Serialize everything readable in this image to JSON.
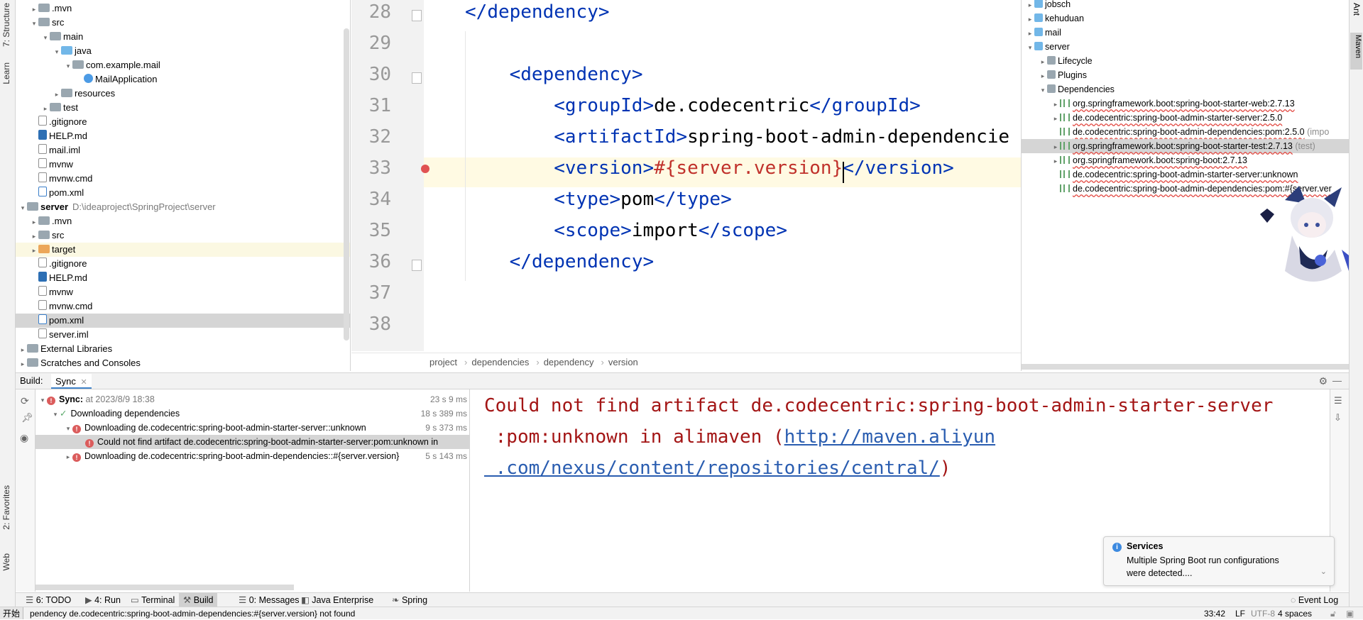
{
  "left_stripe": {
    "tabs": [
      "7: Structure",
      "Learn",
      "2: Favorites",
      "Web"
    ]
  },
  "project_tree": [
    {
      "label": ".mvn",
      "type": "folder",
      "depth": 1,
      "arrow": "▸"
    },
    {
      "label": "src",
      "type": "folder",
      "depth": 1,
      "arrow": "▾"
    },
    {
      "label": "main",
      "type": "folder",
      "depth": 2,
      "arrow": "▾"
    },
    {
      "label": "java",
      "type": "folder-blue",
      "depth": 3,
      "arrow": "▾"
    },
    {
      "label": "com.example.mail",
      "type": "folder",
      "depth": 4,
      "arrow": "▾"
    },
    {
      "label": "MailApplication",
      "type": "java",
      "depth": 5,
      "arrow": ""
    },
    {
      "label": "resources",
      "type": "folder",
      "depth": 3,
      "arrow": "▸"
    },
    {
      "label": "test",
      "type": "folder",
      "depth": 2,
      "arrow": "▸"
    },
    {
      "label": ".gitignore",
      "type": "file",
      "depth": 1,
      "arrow": ""
    },
    {
      "label": "HELP.md",
      "type": "md",
      "depth": 1,
      "arrow": ""
    },
    {
      "label": "mail.iml",
      "type": "file",
      "depth": 1,
      "arrow": ""
    },
    {
      "label": "mvnw",
      "type": "file",
      "depth": 1,
      "arrow": ""
    },
    {
      "label": "mvnw.cmd",
      "type": "file",
      "depth": 1,
      "arrow": ""
    },
    {
      "label": "pom.xml",
      "type": "xml",
      "depth": 1,
      "arrow": ""
    },
    {
      "label": "server",
      "type": "folder",
      "depth": 0,
      "arrow": "▾",
      "bold": true,
      "path": "D:\\ideaproject\\SpringProject\\server"
    },
    {
      "label": ".mvn",
      "type": "folder",
      "depth": 1,
      "arrow": "▸"
    },
    {
      "label": "src",
      "type": "folder",
      "depth": 1,
      "arrow": "▸"
    },
    {
      "label": "target",
      "type": "folder-orange",
      "depth": 1,
      "arrow": "▸",
      "highlight": true
    },
    {
      "label": ".gitignore",
      "type": "file",
      "depth": 1,
      "arrow": ""
    },
    {
      "label": "HELP.md",
      "type": "md",
      "depth": 1,
      "arrow": ""
    },
    {
      "label": "mvnw",
      "type": "file",
      "depth": 1,
      "arrow": ""
    },
    {
      "label": "mvnw.cmd",
      "type": "file",
      "depth": 1,
      "arrow": ""
    },
    {
      "label": "pom.xml",
      "type": "xml",
      "depth": 1,
      "arrow": "",
      "selected": true
    },
    {
      "label": "server.iml",
      "type": "file",
      "depth": 1,
      "arrow": ""
    },
    {
      "label": "External Libraries",
      "type": "lib",
      "depth": 0,
      "arrow": "▸"
    },
    {
      "label": "Scratches and Consoles",
      "type": "scratch",
      "depth": 0,
      "arrow": "▸"
    }
  ],
  "editor": {
    "line_numbers": [
      "28",
      "29",
      "30",
      "31",
      "32",
      "33",
      "34",
      "35",
      "36",
      "37",
      "38"
    ],
    "lines": [
      {
        "indent": "",
        "parts": [
          {
            "t": "</",
            "c": "tag"
          },
          {
            "t": "dependency",
            "c": "tag"
          },
          {
            "t": ">",
            "c": "tag"
          }
        ]
      },
      {
        "indent": "",
        "parts": []
      },
      {
        "indent": "    ",
        "parts": [
          {
            "t": "<",
            "c": "tag"
          },
          {
            "t": "dependency",
            "c": "tag"
          },
          {
            "t": ">",
            "c": "tag"
          }
        ]
      },
      {
        "indent": "        ",
        "parts": [
          {
            "t": "<",
            "c": "tag"
          },
          {
            "t": "groupId",
            "c": "tag"
          },
          {
            "t": ">",
            "c": "tag"
          },
          {
            "t": "de.codecentric",
            "c": ""
          },
          {
            "t": "</",
            "c": "tag"
          },
          {
            "t": "groupId",
            "c": "tag"
          },
          {
            "t": ">",
            "c": "tag"
          }
        ]
      },
      {
        "indent": "        ",
        "parts": [
          {
            "t": "<",
            "c": "tag"
          },
          {
            "t": "artifactId",
            "c": "tag"
          },
          {
            "t": ">",
            "c": "tag"
          },
          {
            "t": "spring-boot-admin-dependencie",
            "c": ""
          }
        ]
      },
      {
        "indent": "        ",
        "parts": [
          {
            "t": "<",
            "c": "tag"
          },
          {
            "t": "version",
            "c": "tag"
          },
          {
            "t": ">",
            "c": "tag"
          },
          {
            "t": "#{server.version}",
            "c": "err"
          },
          {
            "t": "</",
            "c": "tag"
          },
          {
            "t": "version",
            "c": "tag"
          },
          {
            "t": ">",
            "c": "tag"
          }
        ]
      },
      {
        "indent": "        ",
        "parts": [
          {
            "t": "<",
            "c": "tag"
          },
          {
            "t": "type",
            "c": "tag"
          },
          {
            "t": ">",
            "c": "tag"
          },
          {
            "t": "pom",
            "c": ""
          },
          {
            "t": "</",
            "c": "tag"
          },
          {
            "t": "type",
            "c": "tag"
          },
          {
            "t": ">",
            "c": "tag"
          }
        ]
      },
      {
        "indent": "        ",
        "parts": [
          {
            "t": "<",
            "c": "tag"
          },
          {
            "t": "scope",
            "c": "tag"
          },
          {
            "t": ">",
            "c": "tag"
          },
          {
            "t": "import",
            "c": ""
          },
          {
            "t": "</",
            "c": "tag"
          },
          {
            "t": "scope",
            "c": "tag"
          },
          {
            "t": ">",
            "c": "tag"
          }
        ]
      },
      {
        "indent": "    ",
        "parts": [
          {
            "t": "</",
            "c": "tag"
          },
          {
            "t": "dependency",
            "c": "tag"
          },
          {
            "t": ">",
            "c": "tag"
          }
        ]
      },
      {
        "indent": "",
        "parts": []
      },
      {
        "indent": "",
        "parts": []
      }
    ],
    "breadcrumb": [
      "project",
      "dependencies",
      "dependency",
      "version"
    ]
  },
  "maven": {
    "rows": [
      {
        "label": "jobsch",
        "depth": 0,
        "arrow": "▸",
        "kind": "module"
      },
      {
        "label": "kehuduan",
        "depth": 0,
        "arrow": "▸",
        "kind": "module"
      },
      {
        "label": "mail",
        "depth": 0,
        "arrow": "▸",
        "kind": "module"
      },
      {
        "label": "server",
        "depth": 0,
        "arrow": "▾",
        "kind": "module"
      },
      {
        "label": "Lifecycle",
        "depth": 1,
        "arrow": "▸",
        "kind": "folder"
      },
      {
        "label": "Plugins",
        "depth": 1,
        "arrow": "▸",
        "kind": "folder"
      },
      {
        "label": "Dependencies",
        "depth": 1,
        "arrow": "▾",
        "kind": "folder"
      },
      {
        "label": "org.springframework.boot:spring-boot-starter-web:2.7.13",
        "depth": 2,
        "arrow": "▸",
        "kind": "dep",
        "scope": ""
      },
      {
        "label": "de.codecentric:spring-boot-admin-starter-server:2.5.0",
        "depth": 2,
        "arrow": "▸",
        "kind": "dep",
        "scope": ""
      },
      {
        "label": "de.codecentric:spring-boot-admin-dependencies:pom:2.5.0",
        "depth": 2,
        "arrow": "",
        "kind": "dep",
        "scope": "(impo"
      },
      {
        "label": "org.springframework.boot:spring-boot-starter-test:2.7.13",
        "depth": 2,
        "arrow": "▸",
        "kind": "dep",
        "scope": "(test)",
        "selected": true
      },
      {
        "label": "org.springframework.boot:spring-boot:2.7.13",
        "depth": 2,
        "arrow": "▸",
        "kind": "dep",
        "scope": ""
      },
      {
        "label": "de.codecentric:spring-boot-admin-starter-server:unknown",
        "depth": 2,
        "arrow": "",
        "kind": "dep",
        "scope": ""
      },
      {
        "label": "de.codecentric:spring-boot-admin-dependencies:pom:#{server.ver",
        "depth": 2,
        "arrow": "",
        "kind": "dep",
        "scope": ""
      }
    ]
  },
  "right_stripe": {
    "tabs": [
      "Ant",
      "Maven"
    ]
  },
  "build": {
    "title": "Build:",
    "tab": "Sync",
    "tree": [
      {
        "label": "Sync:",
        "suffix": "at 2023/8/9 18:38",
        "time": "23 s 9 ms",
        "depth": 0,
        "arrow": "▾",
        "status": "error",
        "bold": true
      },
      {
        "label": "Downloading dependencies",
        "suffix": "",
        "time": "18 s 389 ms",
        "depth": 1,
        "arrow": "▾",
        "status": "ok"
      },
      {
        "label": "Downloading de.codecentric:spring-boot-admin-starter-server::unknown",
        "suffix": "",
        "time": "9 s 373 ms",
        "depth": 2,
        "arrow": "▾",
        "status": "error"
      },
      {
        "label": "Could not find artifact de.codecentric:spring-boot-admin-starter-server:pom:unknown in",
        "suffix": "",
        "time": "",
        "depth": 3,
        "arrow": "",
        "status": "error",
        "selected": true
      },
      {
        "label": "Downloading de.codecentric:spring-boot-admin-dependencies::#{server.version}",
        "suffix": "",
        "time": "5 s 143 ms",
        "depth": 2,
        "arrow": "▸",
        "status": "error"
      }
    ],
    "console": {
      "line1": "Could not find artifact de.codecentric:spring-boot-admin-starter-server",
      "line2_text": " :pom:unknown in alimaven (",
      "line2_link": "http://maven.aliyun",
      "line3_link": " .com/nexus/content/repositories/central/",
      "line3_tail": ")"
    }
  },
  "notification": {
    "title": "Services",
    "body_line1": "Multiple Spring Boot run configurations",
    "body_line2": "were detected...."
  },
  "bottom_tabs": [
    {
      "label": "6: TODO",
      "active": false
    },
    {
      "label": "4: Run",
      "active": false
    },
    {
      "label": "Terminal",
      "active": false
    },
    {
      "label": "Build",
      "active": true
    },
    {
      "label": "0: Messages",
      "active": false
    },
    {
      "label": "Java Enterprise",
      "active": false
    },
    {
      "label": "Spring",
      "active": false
    },
    {
      "label": "Event Log",
      "active": false
    }
  ],
  "status_bar": {
    "start": "开始",
    "message": "pendency de.codecentric:spring-boot-admin-dependencies:#{server.version} not found",
    "position": "33:42",
    "line_sep": "LF",
    "encoding": "UTF-8",
    "indent": "4 spaces"
  },
  "colors": {
    "tag": "#0033b3",
    "error": "#c0312b",
    "console_error": "#a31515",
    "link": "#2a5db0",
    "selection": "#d5d5d5"
  }
}
